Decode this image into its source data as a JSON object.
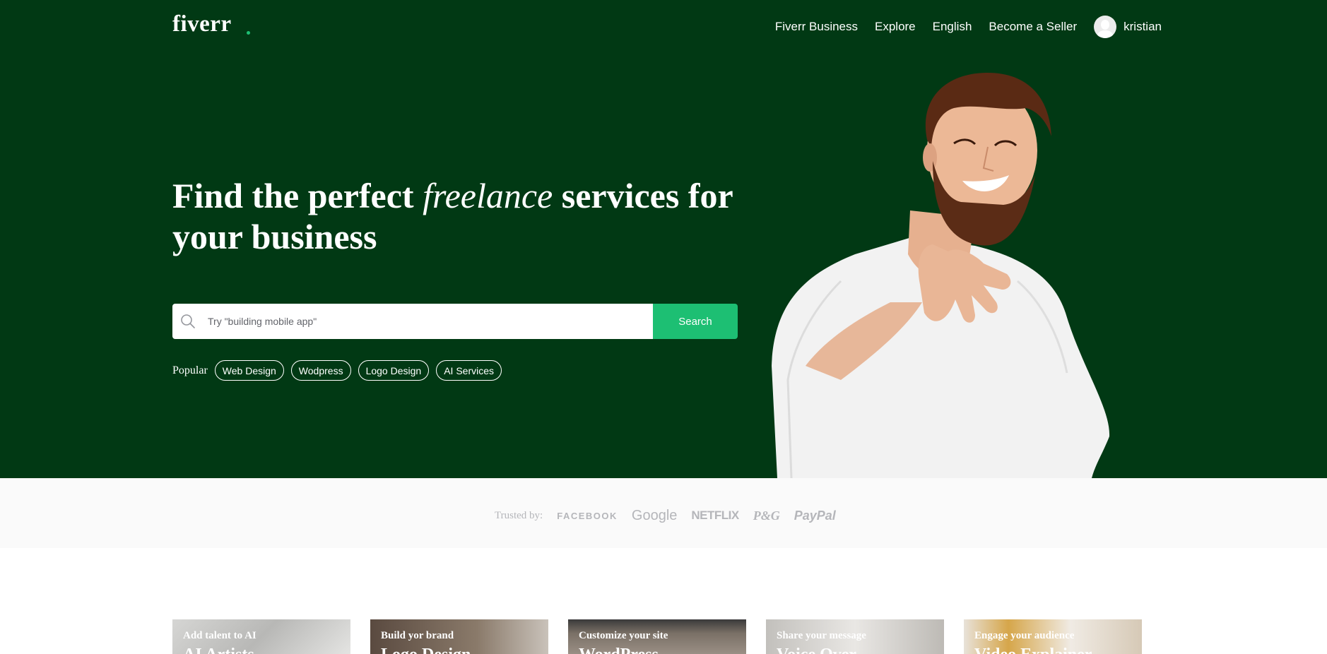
{
  "brand": {
    "name": "fiverr",
    "dot_color": "#1dbf73"
  },
  "colors": {
    "hero_bg": "#013914",
    "accent": "#1dbf73",
    "trusted_bg": "#fafafa"
  },
  "nav": {
    "links": [
      "Fiverr Business",
      "Explore",
      "English",
      "Become a Seller"
    ],
    "user": {
      "name": "kristian",
      "avatar_icon": "avatar-placeholder-icon"
    }
  },
  "hero": {
    "headline_before": "Find the perfect ",
    "headline_emphasis": "freelance",
    "headline_after": " services for your business",
    "search": {
      "placeholder": "Try \"building mobile app\"",
      "value": "",
      "button_label": "Search",
      "icon": "search-icon"
    },
    "popular_label": "Popular",
    "popular_tags": [
      "Web Design",
      "Wodpress",
      "Logo Design",
      "AI Services"
    ]
  },
  "trusted": {
    "label": "Trusted by:",
    "brands": [
      "FACEBOOK",
      "Google",
      "NETFLIX",
      "P&G",
      "PayPal"
    ]
  },
  "services": [
    {
      "subtitle": "Add talent to AI",
      "title": "AI Artists"
    },
    {
      "subtitle": "Build yor brand",
      "title": "Logo Design"
    },
    {
      "subtitle": "Customize your site",
      "title": "WordPress"
    },
    {
      "subtitle": "Share your message",
      "title": "Voice Over"
    },
    {
      "subtitle": "Engage your audience",
      "title": "Video Explainer"
    }
  ]
}
